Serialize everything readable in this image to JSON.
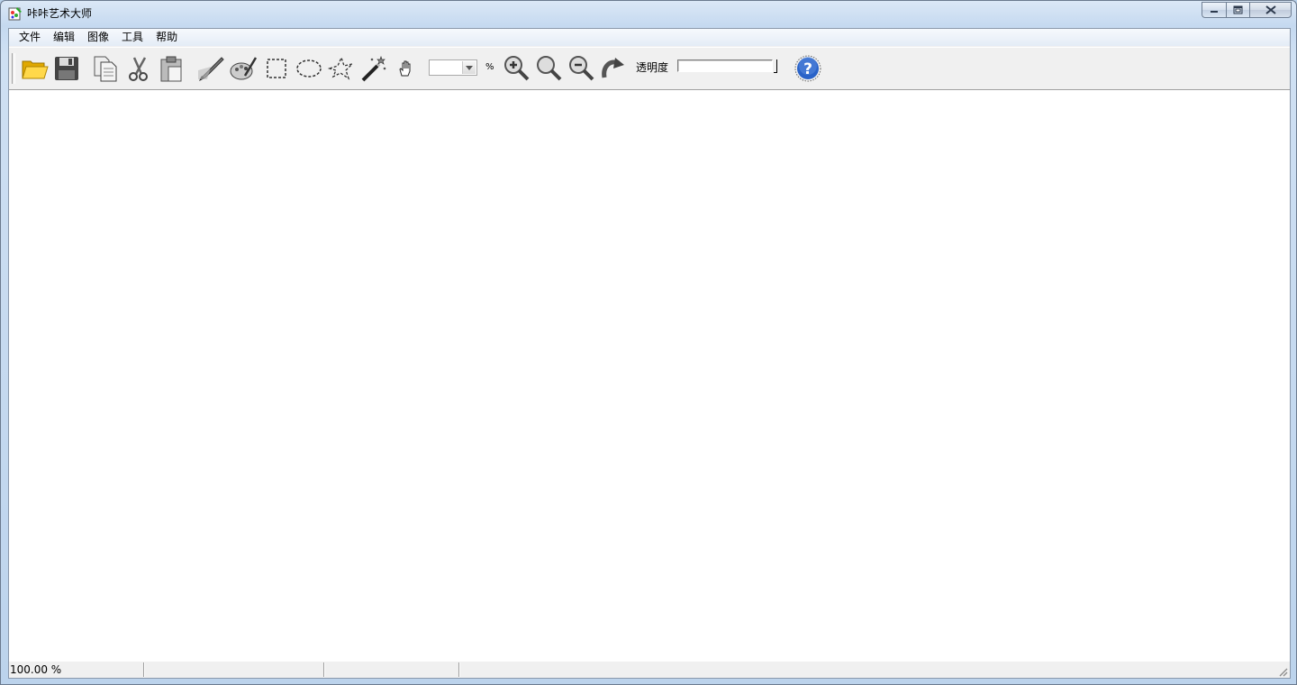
{
  "window": {
    "title": "咔咔艺术大师"
  },
  "menu": {
    "items": [
      "文件",
      "编辑",
      "图像",
      "工具",
      "帮助"
    ]
  },
  "toolbar": {
    "buttons": [
      {
        "name": "open",
        "icon": "folder-open-icon"
      },
      {
        "name": "save",
        "icon": "floppy-disk-icon"
      },
      {
        "name": "copy",
        "icon": "copy-icon"
      },
      {
        "name": "cut",
        "icon": "scissors-icon"
      },
      {
        "name": "paste",
        "icon": "paste-clipboard-icon"
      },
      {
        "name": "pencil",
        "icon": "pencil-icon"
      },
      {
        "name": "palette",
        "icon": "palette-icon"
      },
      {
        "name": "rect-select",
        "icon": "rectangle-select-icon"
      },
      {
        "name": "ellipse-select",
        "icon": "ellipse-select-icon"
      },
      {
        "name": "lasso-select",
        "icon": "lasso-select-icon"
      },
      {
        "name": "magic-wand",
        "icon": "magic-wand-icon"
      },
      {
        "name": "hand",
        "icon": "hand-pan-icon"
      },
      {
        "name": "zoom-in",
        "icon": "zoom-in-icon"
      },
      {
        "name": "zoom-actual",
        "icon": "magnifier-icon"
      },
      {
        "name": "zoom-out",
        "icon": "zoom-out-icon"
      },
      {
        "name": "rotate",
        "icon": "rotate-icon"
      },
      {
        "name": "help",
        "icon": "help-icon"
      }
    ],
    "zoom_value": "",
    "zoom_unit": "%",
    "opacity_label": "透明度",
    "opacity_value": 1.0
  },
  "status": {
    "zoom_text": "100.00 %",
    "panel2": "",
    "panel3": "",
    "panel4": ""
  },
  "colors": {
    "title_bar": "#c5d9f0",
    "canvas": "#ffffff",
    "chrome": "#f0f0f0",
    "help_blue": "#2a63c8",
    "folder_yellow": "#f5c518"
  }
}
